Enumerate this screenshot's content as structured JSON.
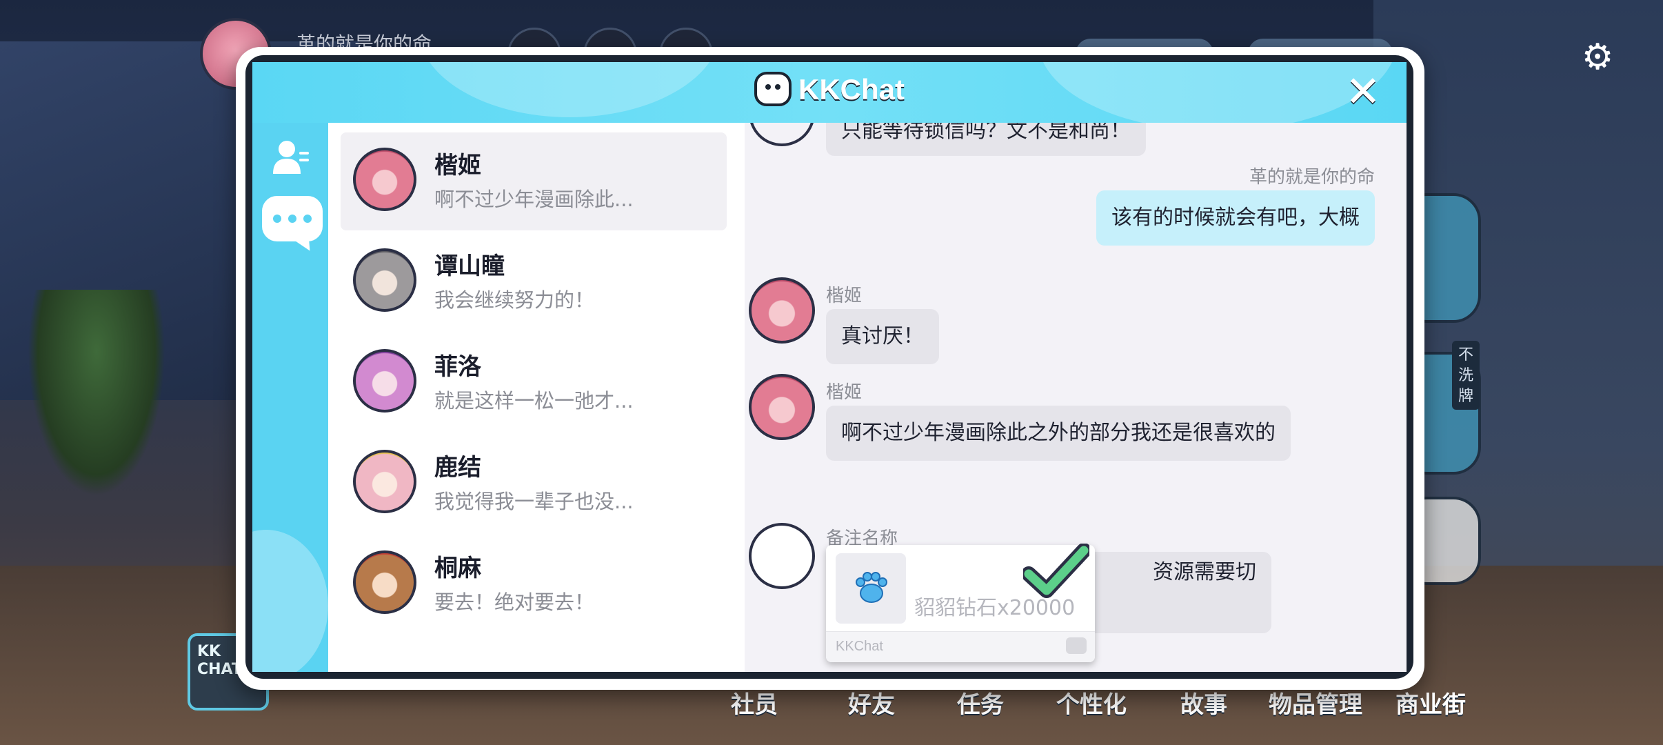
{
  "app": {
    "title": "KKChat",
    "close_label": "✕"
  },
  "game_hud": {
    "player_name": "革的就是你的命",
    "logo_text": "KK CHAT",
    "side_tag": "不洗牌",
    "bottom_nav": [
      "社员",
      "好友",
      "任务",
      "个性化",
      "故事",
      "物品管理",
      "商业街"
    ]
  },
  "contacts": [
    {
      "name": "楷姬",
      "preview": "啊不过少年漫画除此...",
      "active": true
    },
    {
      "name": "谭山瞳",
      "preview": "我会继续努力的！",
      "active": false
    },
    {
      "name": "菲洛",
      "preview": "就是这样一松一弛才...",
      "active": false
    },
    {
      "name": "鹿结",
      "preview": "我觉得我一辈子也没...",
      "active": false
    },
    {
      "name": "桐麻",
      "preview": "要去！绝对要去！",
      "active": false
    }
  ],
  "chat": {
    "top_partial": "只能等待锁信吗？文不是和尚！",
    "my_name": "革的就是你的命",
    "my_message": "该有的时候就会有吧，大概",
    "msg1_name": "楷姬",
    "msg1_text": "真讨厌！",
    "msg2_name": "楷姬",
    "msg2_text": "啊不过少年漫画除此之外的部分我还是很喜欢的",
    "msg3_name": "备注名称",
    "msg3_text": "资源需要切",
    "gift": {
      "text": "貂貂钻石x20000",
      "footer": "KKChat"
    }
  },
  "colors": {
    "accent": "#5ad7f4",
    "my_bubble": "#c6f0fb",
    "other_bubble": "#e5e4ea",
    "check": "#5ccf8a"
  }
}
